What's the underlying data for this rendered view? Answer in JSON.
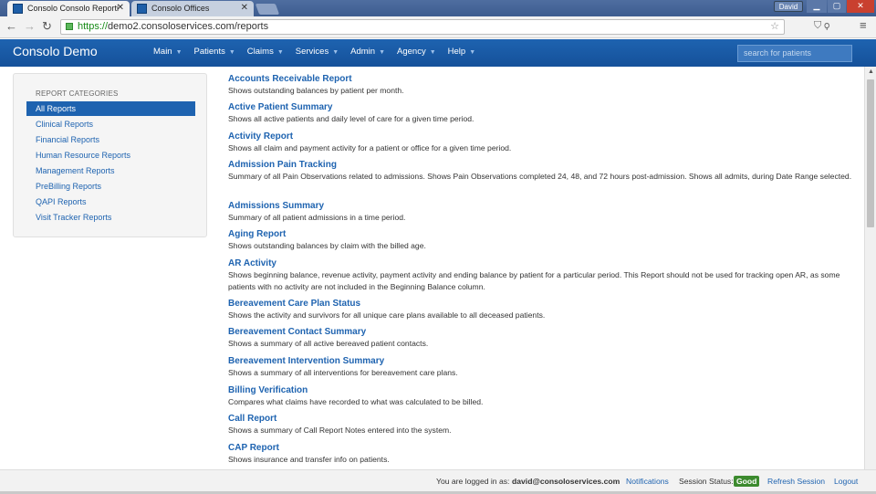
{
  "browser": {
    "tabs": [
      {
        "label": "Consolo Consolo Reporti"
      },
      {
        "label": "Consolo Offices"
      }
    ],
    "user_badge": "David",
    "url_protocol": "https://",
    "url_rest": "demo2.consoloservices.com/reports"
  },
  "app": {
    "brand": "Consolo Demo",
    "nav": [
      {
        "label": "Main"
      },
      {
        "label": "Patients"
      },
      {
        "label": "Claims"
      },
      {
        "label": "Services"
      },
      {
        "label": "Admin"
      },
      {
        "label": "Agency"
      },
      {
        "label": "Help"
      }
    ],
    "search_placeholder": "search for patients"
  },
  "sidebar": {
    "header": "REPORT CATEGORIES",
    "items": [
      {
        "label": "All Reports",
        "active": true
      },
      {
        "label": "Clinical Reports"
      },
      {
        "label": "Financial Reports"
      },
      {
        "label": "Human Resource Reports"
      },
      {
        "label": "Management Reports"
      },
      {
        "label": "PreBilling Reports"
      },
      {
        "label": "QAPI Reports"
      },
      {
        "label": "Visit Tracker Reports"
      }
    ]
  },
  "reports": [
    {
      "title": "Accounts Receivable Report",
      "desc": "Shows outstanding balances by patient per month."
    },
    {
      "title": "Active Patient Summary",
      "desc": "Shows all active patients and daily level of care for a given time period."
    },
    {
      "title": "Activity Report",
      "desc": "Shows all claim and payment activity for a patient or office for a given time period."
    },
    {
      "title": "Admission Pain Tracking",
      "desc": "Summary of all Pain Observations related to admissions. Shows Pain Observations completed 24, 48, and 72 hours post-admission. Shows all admits, during Date Range selected."
    },
    {
      "title": "Admissions Summary",
      "desc": "Summary of all patient admissions in a time period."
    },
    {
      "title": "Aging Report",
      "desc": "Shows outstanding balances by claim with the billed age."
    },
    {
      "title": "AR Activity",
      "desc": "Shows beginning balance, revenue activity, payment activity and ending balance by patient for a particular period. This Report should not be used for tracking open AR, as some patients with no activity are not included in the Beginning Balance column."
    },
    {
      "title": "Bereavement Care Plan Status",
      "desc": "Shows the activity and survivors for all unique care plans available to all deceased patients."
    },
    {
      "title": "Bereavement Contact Summary",
      "desc": "Shows a summary of all active bereaved patient contacts."
    },
    {
      "title": "Bereavement Intervention Summary",
      "desc": "Shows a summary of all interventions for bereavement care plans."
    },
    {
      "title": "Billing Verification",
      "desc": "Compares what claims have recorded to what was calculated to be billed."
    },
    {
      "title": "Call Report",
      "desc": "Shows a summary of Call Report Notes entered into the system."
    },
    {
      "title": "CAP Report",
      "desc": "Shows insurance and transfer info on patients."
    }
  ],
  "footer": {
    "logged_in_prefix": "You are logged in as:",
    "user_email": "david@consoloservices.com",
    "notifications": "Notifications",
    "session_label": "Session Status:",
    "session_status": "Good",
    "refresh": "Refresh Session",
    "logout": "Logout"
  },
  "colors": {
    "brand_blue": "#1e63b0",
    "status_good": "#3c8a2e"
  }
}
